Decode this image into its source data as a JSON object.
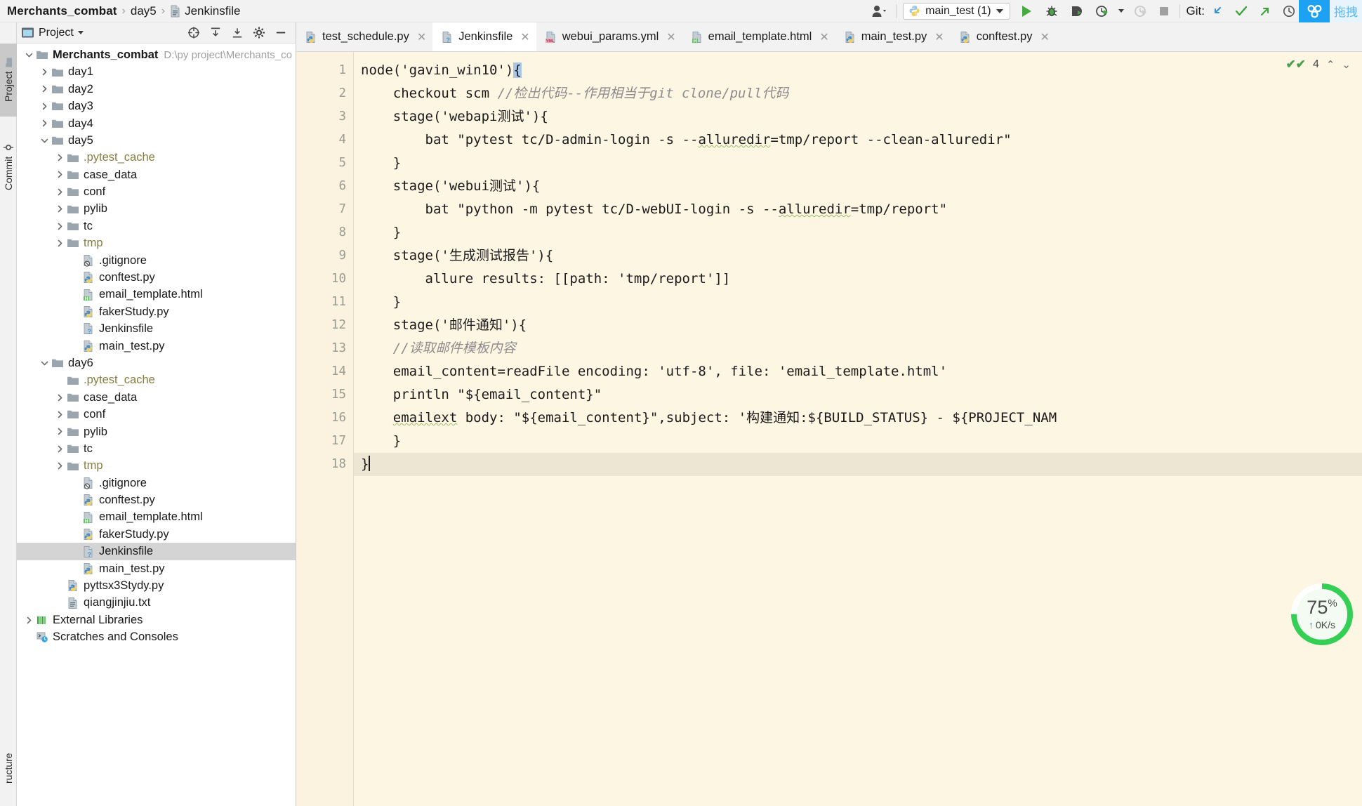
{
  "window": {
    "breadcrumb": {
      "project": "Merchants_combat",
      "sep": "›",
      "folder": "day5",
      "file": "Jenkinsfile"
    }
  },
  "toolbar": {
    "user_icon": "user-profile-icon",
    "run_config": {
      "label": "main_test (1)",
      "icon": "python-file-icon"
    },
    "actions": [
      {
        "name": "run-button",
        "glyph": "▶",
        "color": "#45a945"
      },
      {
        "name": "debug-button",
        "glyph": "bug",
        "color": "#45a945"
      },
      {
        "name": "run-with-coverage-button",
        "glyph": "coverage",
        "color": "#45a945"
      },
      {
        "name": "profile-button",
        "glyph": "profiler",
        "color": "#45a945"
      },
      {
        "name": "rerun-disabled-button",
        "glyph": "profiler",
        "color": "#c9c9c9"
      },
      {
        "name": "stop-button",
        "glyph": "■",
        "color": "#9a9a9a"
      }
    ],
    "git": {
      "label": "Git:",
      "update_project": "↙",
      "commit": "✔",
      "push": "↗",
      "history": "◴"
    },
    "plugin_tile": "share-icon",
    "cjk_tile": "拖拽"
  },
  "tool_strip": {
    "tabs": [
      {
        "label": "Project",
        "icon": "folder-icon",
        "selected": true
      },
      {
        "label": "Commit",
        "icon": "commit-icon",
        "selected": false
      }
    ],
    "bottom_tab": {
      "label": "ructure",
      "icon": "structure-icon"
    }
  },
  "project_panel": {
    "title": "Project",
    "header_icons": [
      "scope-target-icon",
      "expand-all-icon",
      "collapse-all-icon",
      "settings-gear-icon",
      "hide-panel-icon"
    ],
    "tree": [
      {
        "depth": 0,
        "twisty": "open",
        "icon": "folder",
        "label": "Merchants_combat",
        "bold": true,
        "path": "D:\\py project\\Merchants_combat"
      },
      {
        "depth": 1,
        "twisty": "closed",
        "icon": "folder",
        "label": "day1"
      },
      {
        "depth": 1,
        "twisty": "closed",
        "icon": "folder",
        "label": "day2"
      },
      {
        "depth": 1,
        "twisty": "closed",
        "icon": "folder",
        "label": "day3"
      },
      {
        "depth": 1,
        "twisty": "closed",
        "icon": "folder",
        "label": "day4"
      },
      {
        "depth": 1,
        "twisty": "open",
        "icon": "folder",
        "label": "day5"
      },
      {
        "depth": 2,
        "twisty": "closed",
        "icon": "folder",
        "label": ".pytest_cache",
        "excluded": true
      },
      {
        "depth": 2,
        "twisty": "closed",
        "icon": "folder",
        "label": "case_data"
      },
      {
        "depth": 2,
        "twisty": "closed",
        "icon": "folder",
        "label": "conf"
      },
      {
        "depth": 2,
        "twisty": "closed",
        "icon": "folder",
        "label": "pylib"
      },
      {
        "depth": 2,
        "twisty": "closed",
        "icon": "folder",
        "label": "tc"
      },
      {
        "depth": 2,
        "twisty": "closed",
        "icon": "folder",
        "label": "tmp",
        "excluded": true
      },
      {
        "depth": 3,
        "twisty": "none",
        "icon": "gitignore",
        "label": ".gitignore"
      },
      {
        "depth": 3,
        "twisty": "none",
        "icon": "python",
        "label": "conftest.py"
      },
      {
        "depth": 3,
        "twisty": "none",
        "icon": "html",
        "label": "email_template.html"
      },
      {
        "depth": 3,
        "twisty": "none",
        "icon": "python",
        "label": "fakerStudy.py"
      },
      {
        "depth": 3,
        "twisty": "none",
        "icon": "jenkins",
        "label": "Jenkinsfile"
      },
      {
        "depth": 3,
        "twisty": "none",
        "icon": "python",
        "label": "main_test.py"
      },
      {
        "depth": 1,
        "twisty": "open",
        "icon": "folder",
        "label": "day6"
      },
      {
        "depth": 2,
        "twisty": "none",
        "icon": "folder",
        "label": ".pytest_cache",
        "excluded": true
      },
      {
        "depth": 2,
        "twisty": "closed",
        "icon": "folder",
        "label": "case_data"
      },
      {
        "depth": 2,
        "twisty": "closed",
        "icon": "folder",
        "label": "conf"
      },
      {
        "depth": 2,
        "twisty": "closed",
        "icon": "folder",
        "label": "pylib"
      },
      {
        "depth": 2,
        "twisty": "closed",
        "icon": "folder",
        "label": "tc"
      },
      {
        "depth": 2,
        "twisty": "closed",
        "icon": "folder",
        "label": "tmp",
        "excluded": true
      },
      {
        "depth": 3,
        "twisty": "none",
        "icon": "gitignore",
        "label": ".gitignore"
      },
      {
        "depth": 3,
        "twisty": "none",
        "icon": "python",
        "label": "conftest.py"
      },
      {
        "depth": 3,
        "twisty": "none",
        "icon": "html",
        "label": "email_template.html"
      },
      {
        "depth": 3,
        "twisty": "none",
        "icon": "python",
        "label": "fakerStudy.py"
      },
      {
        "depth": 3,
        "twisty": "none",
        "icon": "jenkins",
        "label": "Jenkinsfile",
        "selected": true
      },
      {
        "depth": 3,
        "twisty": "none",
        "icon": "python",
        "label": "main_test.py"
      },
      {
        "depth": 2,
        "twisty": "none",
        "icon": "python",
        "label": "pyttsx3Stydy.py"
      },
      {
        "depth": 2,
        "twisty": "none",
        "icon": "text",
        "label": "qiangjinjiu.txt"
      },
      {
        "depth": 0,
        "twisty": "closed",
        "icon": "library",
        "label": "External Libraries"
      },
      {
        "depth": 0,
        "twisty": "none",
        "icon": "scratches",
        "label": "Scratches and Consoles"
      }
    ]
  },
  "editor": {
    "tabs": [
      {
        "label": "test_schedule.py",
        "icon": "python",
        "active": false
      },
      {
        "label": "Jenkinsfile",
        "icon": "jenkins",
        "active": true
      },
      {
        "label": "webui_params.yml",
        "icon": "yaml",
        "active": false
      },
      {
        "label": "email_template.html",
        "icon": "html",
        "active": false
      },
      {
        "label": "main_test.py",
        "icon": "python",
        "active": false
      },
      {
        "label": "conftest.py",
        "icon": "python",
        "active": false
      }
    ],
    "close_glyph": "✕",
    "inspection": {
      "count": "4",
      "check_glyph": "✔✔",
      "up_glyph": "⌃",
      "down_glyph": "⌄"
    },
    "current_line": 18,
    "lines": [
      {
        "n": 1,
        "text": "node('gavin_win10'){",
        "brace_hl_tail": 1
      },
      {
        "n": 2,
        "text": "    checkout scm ",
        "comment": "//检出代码--作用相当于git clone/pull代码"
      },
      {
        "n": 3,
        "text": "    stage('webapi测试'){"
      },
      {
        "n": 4,
        "text": "        bat \"pytest tc/D-admin-login -s --alluredir=tmp/report --clean-alluredir\"",
        "squiggle_word": "alluredir"
      },
      {
        "n": 5,
        "text": "    }"
      },
      {
        "n": 6,
        "text": "    stage('webui测试'){"
      },
      {
        "n": 7,
        "text": "        bat \"python -m pytest tc/D-webUI-login -s --alluredir=tmp/report\"",
        "squiggle_word": "alluredir"
      },
      {
        "n": 8,
        "text": "    }"
      },
      {
        "n": 9,
        "text": "    stage('生成测试报告'){"
      },
      {
        "n": 10,
        "text": "        allure results: [[path: 'tmp/report']]"
      },
      {
        "n": 11,
        "text": "    }"
      },
      {
        "n": 12,
        "text": "    stage('邮件通知'){"
      },
      {
        "n": 13,
        "text": "    ",
        "comment": "//读取邮件模板内容"
      },
      {
        "n": 14,
        "text": "    email_content=readFile encoding: 'utf-8', file: 'email_template.html'"
      },
      {
        "n": 15,
        "text": "    println \"${email_content}\""
      },
      {
        "n": 16,
        "text": "    emailext body: \"${email_content}\",subject: '构建通知:${BUILD_STATUS} - ${PROJECT_NAM",
        "squiggle_word": "emailext"
      },
      {
        "n": 17,
        "text": "    }"
      },
      {
        "n": 18,
        "text": "}",
        "caret_after": true
      }
    ]
  },
  "progress_widget": {
    "percent": "75",
    "percent_suffix": "%",
    "speed": "0K/s",
    "arrow": "↑",
    "ring_color": "#34cf54",
    "value": 75
  }
}
